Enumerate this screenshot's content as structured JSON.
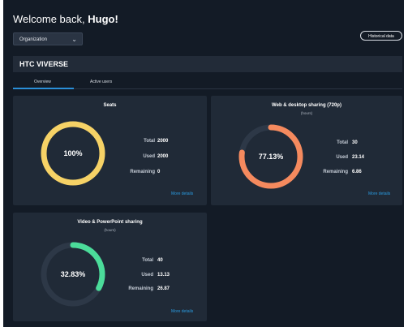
{
  "header": {
    "greeting": "Welcome back, ",
    "user_name": "Hugo!",
    "org_select": "Organization",
    "historical_button": "Historical data"
  },
  "org_name": "HTC VIVERSE",
  "tabs": [
    {
      "label": "Overview",
      "active": true
    },
    {
      "label": "Active users",
      "active": false
    }
  ],
  "cards": {
    "seats": {
      "title": "Seats",
      "subtitle": "",
      "percent_label": "100%",
      "fraction": 1.0,
      "color": "#f6d266",
      "stats": [
        {
          "label": "Total",
          "value": "2000"
        },
        {
          "label": "Used",
          "value": "2000"
        },
        {
          "label": "Remaining",
          "value": "0"
        }
      ],
      "more": "More details"
    },
    "web": {
      "title": "Web & desktop sharing (720p)",
      "subtitle": "(hours)",
      "percent_label": "77.13%",
      "fraction": 0.7713,
      "color": "#f58a5e",
      "stats": [
        {
          "label": "Total",
          "value": "30"
        },
        {
          "label": "Used",
          "value": "23.14"
        },
        {
          "label": "Remaining",
          "value": "6.86"
        }
      ],
      "more": "More details"
    },
    "video": {
      "title": "Video & PowerPoint sharing",
      "subtitle": "(hours)",
      "percent_label": "32.83%",
      "fraction": 0.3283,
      "color": "#4bdc9a",
      "stats": [
        {
          "label": "Total",
          "value": "40"
        },
        {
          "label": "Used",
          "value": "13.13"
        },
        {
          "label": "Remaining",
          "value": "26.87"
        }
      ],
      "more": "More details"
    }
  },
  "colors": {
    "background": "#131b26",
    "card": "#202a37",
    "track": "#2d3847",
    "accent": "#2a8fd8"
  }
}
